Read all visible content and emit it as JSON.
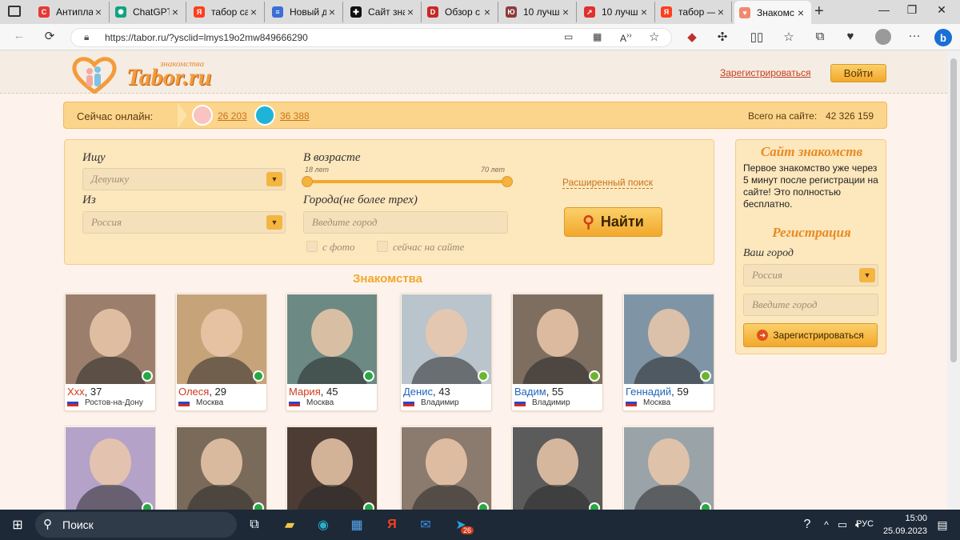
{
  "browser": {
    "tabs": [
      {
        "title": "Антипла",
        "icon_color": "#e53935",
        "icon": "C"
      },
      {
        "title": "ChatGPT",
        "icon_color": "#10a37f",
        "icon": "✺"
      },
      {
        "title": "табор са",
        "icon_color": "#fc3f1d",
        "icon": "Я"
      },
      {
        "title": "Новый д",
        "icon_color": "#3b6fd6",
        "icon": "≡"
      },
      {
        "title": "Сайт зна",
        "icon_color": "#111111",
        "icon": "✚"
      },
      {
        "title": "Обзор с",
        "icon_color": "#c62828",
        "icon": "D"
      },
      {
        "title": "10 лучш",
        "icon_color": "#8d3a3a",
        "icon": "Ю"
      },
      {
        "title": "10 лучш",
        "icon_color": "#e03030",
        "icon": "➚"
      },
      {
        "title": "табор —",
        "icon_color": "#fc3f1d",
        "icon": "Я"
      },
      {
        "title": "Знакомс",
        "icon_color": "#f08a6e",
        "icon": "♥"
      }
    ],
    "url": "https://tabor.ru/?ysclid=lmys19o2mw849666290"
  },
  "header": {
    "logo_small": "знакомства",
    "logo_text": "Tabor.ru",
    "register_link": "Зарегистрироваться",
    "login_button": "Войти"
  },
  "online": {
    "label": "Сейчас онлайн:",
    "women_count": "26 203",
    "men_count": "36 388",
    "total_label": "Всего на сайте:",
    "total_count": "42 326 159"
  },
  "search": {
    "seek_label": "Ищу",
    "seek_value": "Девушку",
    "from_label": "Из",
    "from_value": "Россия",
    "age_label": "В возрасте",
    "age_min": "18 лет",
    "age_max": "70 лет",
    "cities_label": "Города(не более трех)",
    "city_placeholder": "Введите город",
    "with_photo": "с фото",
    "online_now": "сейчас на сайте",
    "advanced": "Расширенный поиск",
    "find_button": "Найти"
  },
  "section_title": "Знакомства",
  "profiles": [
    {
      "name": "Ххх",
      "age": ", 37",
      "city": "Ростов-на-Дону",
      "gender": "f",
      "status": "online",
      "bg": "#9b7f6c"
    },
    {
      "name": "Олеся",
      "age": ", 29",
      "city": "Москва",
      "gender": "f",
      "status": "online",
      "bg": "#c7a37a"
    },
    {
      "name": "Мария",
      "age": ", 45",
      "city": "Москва",
      "gender": "f",
      "status": "online",
      "bg": "#6c8a83"
    },
    {
      "name": "Денис",
      "age": ", 43",
      "city": "Владимир",
      "gender": "m",
      "status": "mobile",
      "bg": "#b9c4cc"
    },
    {
      "name": "Вадим",
      "age": ", 55",
      "city": "Владимир",
      "gender": "m",
      "status": "mobile",
      "bg": "#7d6e60"
    },
    {
      "name": "Геннадий",
      "age": ", 59",
      "city": "Москва",
      "gender": "m",
      "status": "mobile",
      "bg": "#7f95a6"
    }
  ],
  "profiles_row2": [
    {
      "bg": "#b5a2c9"
    },
    {
      "bg": "#7a6a5a"
    },
    {
      "bg": "#4d3c34"
    },
    {
      "bg": "#8b7a6e"
    },
    {
      "bg": "#5b5b5b"
    },
    {
      "bg": "#9aa3a8"
    }
  ],
  "sidebar": {
    "title": "Сайт знакомств",
    "description": "Первое знакомство уже через 5 минут после регистрации на сайте! Это полностью бесплатно.",
    "reg_title": "Регистрация",
    "city_label": "Ваш город",
    "country_value": "Россия",
    "city_placeholder": "Введите город",
    "register_button": "Зарегистрироваться"
  },
  "taskbar": {
    "search_label": "Поиск",
    "lang": "РУС",
    "time": "15:00",
    "date": "25.09.2023",
    "telegram_badge": "26"
  },
  "colors": {
    "female_name": "#d03a1a",
    "male_name": "#2266bb",
    "accent": "#f2a82b"
  }
}
